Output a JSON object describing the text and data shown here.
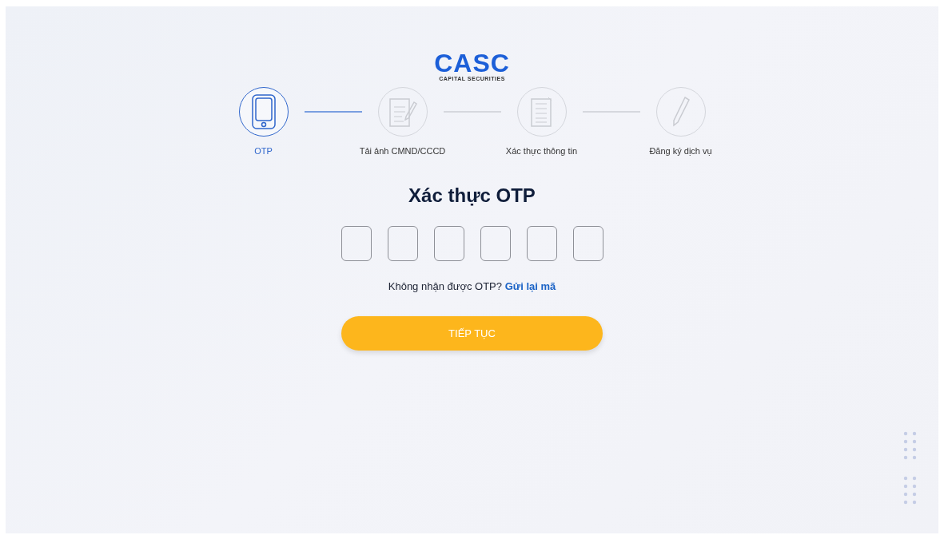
{
  "logo": {
    "mark": "CASC",
    "tagline": "CAPITAL SECURITIES"
  },
  "steps": [
    {
      "label": "OTP",
      "kind": "phone",
      "selected": true
    },
    {
      "label": "Tải ảnh CMND/CCCD",
      "kind": "document-pen",
      "selected": false
    },
    {
      "label": "Xác thực thông tin",
      "kind": "document",
      "selected": false
    },
    {
      "label": "Đăng ký dịch vụ",
      "kind": "pen",
      "selected": false
    }
  ],
  "title": "Xác thực OTP",
  "resend": {
    "prompt": "Không nhận được OTP?",
    "link": "Gửi lại mã"
  },
  "button": "TIẾP TỤC"
}
